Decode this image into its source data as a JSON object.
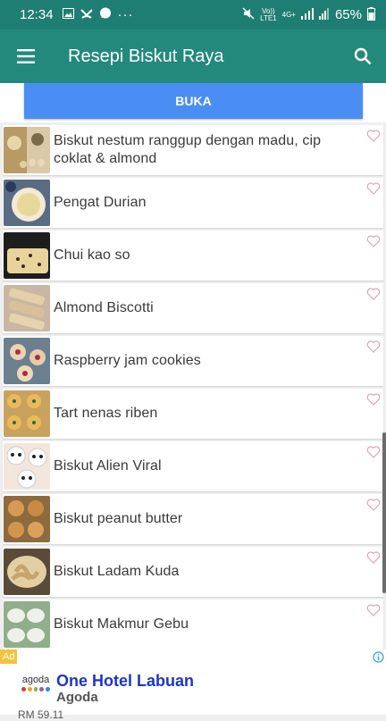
{
  "status_bar": {
    "time": "12:34",
    "battery": "65%",
    "more": "···",
    "volte": "Vo))",
    "lte": "LTE1",
    "net": "4G+"
  },
  "app_bar": {
    "title": "Resepi Biskut Raya"
  },
  "open_button": {
    "label": "BUKA"
  },
  "recipes": [
    {
      "title": "Biskut nestum ranggup dengan madu, cip coklat & almond"
    },
    {
      "title": "Pengat Durian"
    },
    {
      "title": "Chui kao so"
    },
    {
      "title": "Almond Biscotti"
    },
    {
      "title": "Raspberry jam cookies"
    },
    {
      "title": "Tart nenas riben"
    },
    {
      "title": "Biskut Alien Viral"
    },
    {
      "title": "Biskut peanut butter"
    },
    {
      "title": "Biskut Ladam Kuda"
    },
    {
      "title": "Biskut Makmur Gebu"
    }
  ],
  "ad": {
    "badge": "Ad",
    "brand": "agoda",
    "title": "One Hotel Labuan",
    "advertiser": "Agoda",
    "price": "RM 59.11"
  },
  "colors": {
    "status_bar": "#1f7e73",
    "app_bar": "#23897c",
    "button": "#4a8ef3",
    "heart": "#e0a3b3"
  }
}
